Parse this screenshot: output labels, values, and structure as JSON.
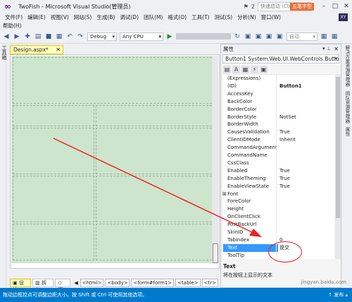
{
  "window": {
    "title": "TwoFish - Microsoft Visual Studio(管理员)",
    "notif_count": "2",
    "quick_launch_placeholder": "快速启动 (Ctrl+Q)",
    "badge": "五笔字型"
  },
  "menu": [
    "文件(F)",
    "编辑(E)",
    "视图(V)",
    "网站(S)",
    "生成(B)",
    "调试(D)",
    "团队(M)",
    "格式(O)",
    "工具(T)",
    "测试(S)",
    "分析(N)",
    "窗口(W)"
  ],
  "menu_row2": [
    "帮助(H)"
  ],
  "user_initials": "XY",
  "toolbar": {
    "config": "Debug",
    "platform": "Any CPU",
    "auto_label": "自动"
  },
  "left_strip_label": "工具箱",
  "doc_tab": "Design.aspx*",
  "properties": {
    "title": "属性",
    "object": "Button1  System.Web.UI.WebControls.Button",
    "rows": [
      {
        "name": "(Expressions)",
        "value": ""
      },
      {
        "name": "(ID)",
        "value": "Button1"
      },
      {
        "name": "AccessKey",
        "value": ""
      },
      {
        "name": "BackColor",
        "value": ""
      },
      {
        "name": "BorderColor",
        "value": ""
      },
      {
        "name": "BorderStyle",
        "value": "NotSet"
      },
      {
        "name": "BorderWidth",
        "value": ""
      },
      {
        "name": "CausesValidation",
        "value": "True"
      },
      {
        "name": "ClientIDMode",
        "value": "Inherit"
      },
      {
        "name": "CommandArgument",
        "value": ""
      },
      {
        "name": "CommandName",
        "value": ""
      },
      {
        "name": "CssClass",
        "value": ""
      },
      {
        "name": "Enabled",
        "value": "True"
      },
      {
        "name": "EnableTheming",
        "value": "True"
      },
      {
        "name": "EnableViewState",
        "value": "True"
      },
      {
        "name": "Font",
        "value": ""
      },
      {
        "name": "ForeColor",
        "value": ""
      },
      {
        "name": "Height",
        "value": ""
      },
      {
        "name": "OnClientClick",
        "value": ""
      },
      {
        "name": "PostBackUrl",
        "value": ""
      },
      {
        "name": "SkinID",
        "value": ""
      },
      {
        "name": "TabIndex",
        "value": "0"
      },
      {
        "name": "Text",
        "value": "提交"
      },
      {
        "name": "ToolTip",
        "value": ""
      }
    ],
    "desc_title": "Text",
    "desc_text": "将在按钮上显示的文本"
  },
  "right_strip": [
    "解决方案资源管理器",
    "团队资源管理器",
    "属性"
  ],
  "view_tabs": {
    "design": "设计",
    "split": "拆分",
    "source": "源"
  },
  "breadcrumb": [
    "<html>",
    "<body>",
    "<form#form1>",
    "<table>",
    "<tr>"
  ],
  "status": "拖动边框控点可调整边距大小。按 Shift 或 Ctrl 可使用其他选项。",
  "publish": "↑ 发布 ▴",
  "watermark": "jingyan.baidu.com"
}
